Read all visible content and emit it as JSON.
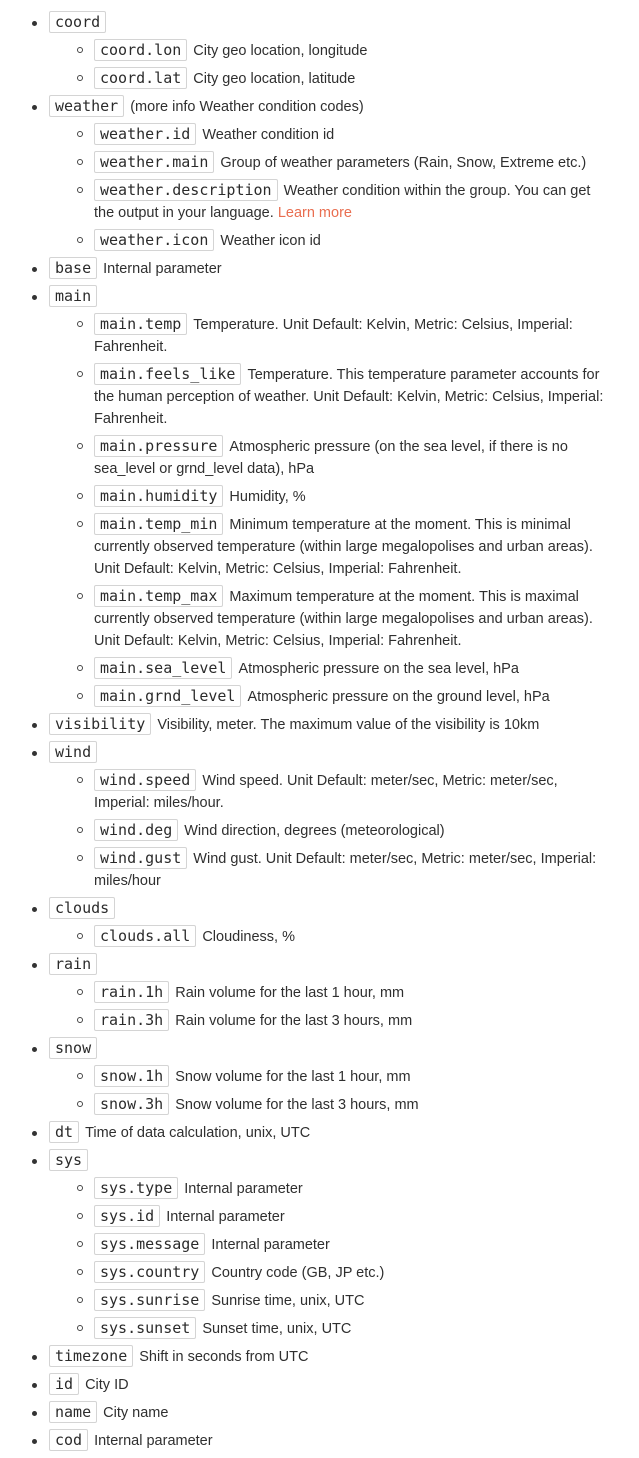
{
  "fields": [
    {
      "name": "coord",
      "desc": "",
      "children": [
        {
          "name": "coord.lon",
          "desc": "City geo location, longitude"
        },
        {
          "name": "coord.lat",
          "desc": "City geo location, latitude"
        }
      ]
    },
    {
      "name": "weather",
      "desc": "(more info Weather condition codes)",
      "children": [
        {
          "name": "weather.id",
          "desc": "Weather condition id"
        },
        {
          "name": "weather.main",
          "desc": "Group of weather parameters (Rain, Snow, Extreme etc.)"
        },
        {
          "name": "weather.description",
          "desc": "Weather condition within the group. You can get the output in your language.",
          "link": "Learn more"
        },
        {
          "name": "weather.icon",
          "desc": "Weather icon id"
        }
      ]
    },
    {
      "name": "base",
      "desc": "Internal parameter"
    },
    {
      "name": "main",
      "desc": "",
      "children": [
        {
          "name": "main.temp",
          "desc": "Temperature. Unit Default: Kelvin, Metric: Celsius, Imperial: Fahrenheit."
        },
        {
          "name": "main.feels_like",
          "desc": "Temperature. This temperature parameter accounts for the human perception of weather. Unit Default: Kelvin, Metric: Celsius, Imperial: Fahrenheit."
        },
        {
          "name": "main.pressure",
          "desc": "Atmospheric pressure (on the sea level, if there is no sea_level or grnd_level data), hPa"
        },
        {
          "name": "main.humidity",
          "desc": "Humidity, %"
        },
        {
          "name": "main.temp_min",
          "desc": "Minimum temperature at the moment. This is minimal currently observed temperature (within large megalopolises and urban areas). Unit Default: Kelvin, Metric: Celsius, Imperial: Fahrenheit."
        },
        {
          "name": "main.temp_max",
          "desc": "Maximum temperature at the moment. This is maximal currently observed temperature (within large megalopolises and urban areas). Unit Default: Kelvin, Metric: Celsius, Imperial: Fahrenheit."
        },
        {
          "name": "main.sea_level",
          "desc": "Atmospheric pressure on the sea level, hPa"
        },
        {
          "name": "main.grnd_level",
          "desc": "Atmospheric pressure on the ground level, hPa"
        }
      ]
    },
    {
      "name": "visibility",
      "desc": "Visibility, meter. The maximum value of the visibility is 10km"
    },
    {
      "name": "wind",
      "desc": "",
      "children": [
        {
          "name": "wind.speed",
          "desc": "Wind speed. Unit Default: meter/sec, Metric: meter/sec, Imperial: miles/hour."
        },
        {
          "name": "wind.deg",
          "desc": "Wind direction, degrees (meteorological)"
        },
        {
          "name": "wind.gust",
          "desc": "Wind gust. Unit Default: meter/sec, Metric: meter/sec, Imperial: miles/hour"
        }
      ]
    },
    {
      "name": "clouds",
      "desc": "",
      "children": [
        {
          "name": "clouds.all",
          "desc": "Cloudiness, %"
        }
      ]
    },
    {
      "name": "rain",
      "desc": "",
      "children": [
        {
          "name": "rain.1h",
          "desc": "Rain volume for the last 1 hour, mm"
        },
        {
          "name": "rain.3h",
          "desc": "Rain volume for the last 3 hours, mm"
        }
      ]
    },
    {
      "name": "snow",
      "desc": "",
      "children": [
        {
          "name": "snow.1h",
          "desc": "Snow volume for the last 1 hour, mm"
        },
        {
          "name": "snow.3h",
          "desc": "Snow volume for the last 3 hours, mm"
        }
      ]
    },
    {
      "name": "dt",
      "desc": "Time of data calculation, unix, UTC"
    },
    {
      "name": "sys",
      "desc": "",
      "children": [
        {
          "name": "sys.type",
          "desc": "Internal parameter"
        },
        {
          "name": "sys.id",
          "desc": "Internal parameter"
        },
        {
          "name": "sys.message",
          "desc": "Internal parameter"
        },
        {
          "name": "sys.country",
          "desc": "Country code (GB, JP etc.)"
        },
        {
          "name": "sys.sunrise",
          "desc": "Sunrise time, unix, UTC"
        },
        {
          "name": "sys.sunset",
          "desc": "Sunset time, unix, UTC"
        }
      ]
    },
    {
      "name": "timezone",
      "desc": "Shift in seconds from UTC"
    },
    {
      "name": "id",
      "desc": "City ID"
    },
    {
      "name": "name",
      "desc": "City name"
    },
    {
      "name": "cod",
      "desc": "Internal parameter"
    }
  ]
}
